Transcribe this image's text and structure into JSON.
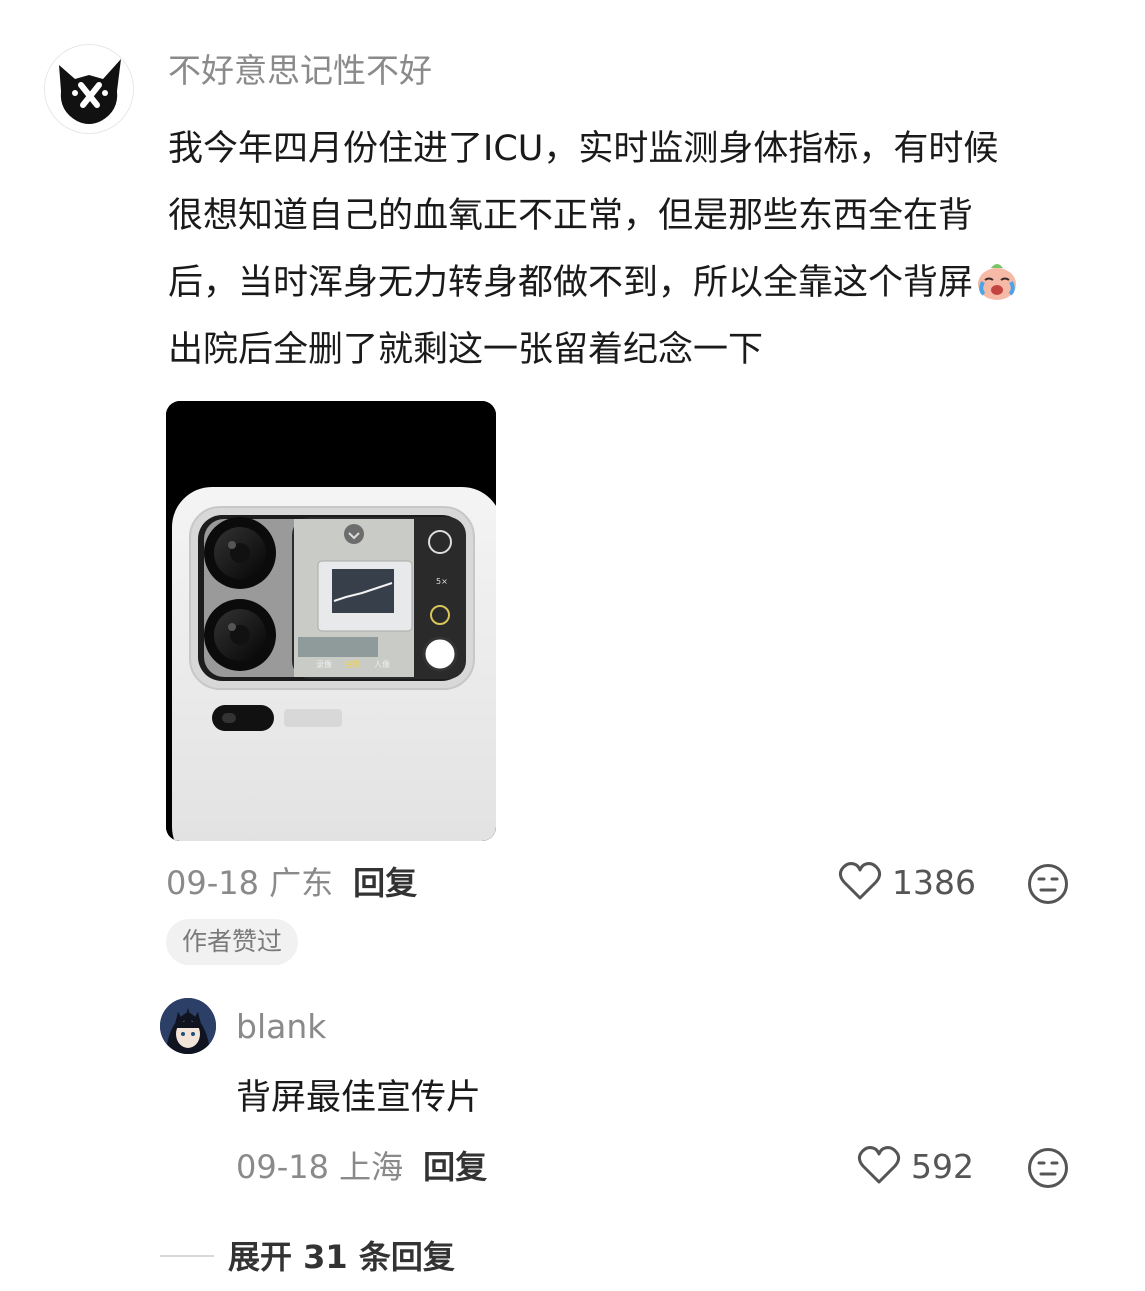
{
  "comment": {
    "username": "不好意思记性不好",
    "avatar_icon": "cat-avatar-icon",
    "lines": [
      "我今年四月份住进了ICU，实时监测身体指标，有时候",
      "很想知道自己的血氧正不正常，但是那些东西全在背",
      "后，当时浑身无力转身都做不到，所以全靠这个背屏",
      "出院后全删了就剩这一张留着纪念一下"
    ],
    "emoji": "crying-emoji-icon",
    "photo": {
      "description_icon": "phone-rear-screen-photo",
      "modes": [
        "录像",
        "拍照",
        "人像"
      ],
      "zoom_label": "5×"
    },
    "date_location": "09-18 广东",
    "reply_label": "回复",
    "like_count": "1386",
    "author_liked_badge": "作者赞过"
  },
  "reply": {
    "username": "blank",
    "avatar_icon": "anime-avatar-icon",
    "text": "背屏最佳宣传片",
    "date_location": "09-18 上海",
    "reply_label": "回复",
    "like_count": "592"
  },
  "expand": {
    "label": "展开 31 条回复"
  },
  "colors": {
    "meta_gray": "#8a8a8a",
    "text_dark": "#1a1a1a",
    "badge_bg": "#f1f1f1"
  }
}
